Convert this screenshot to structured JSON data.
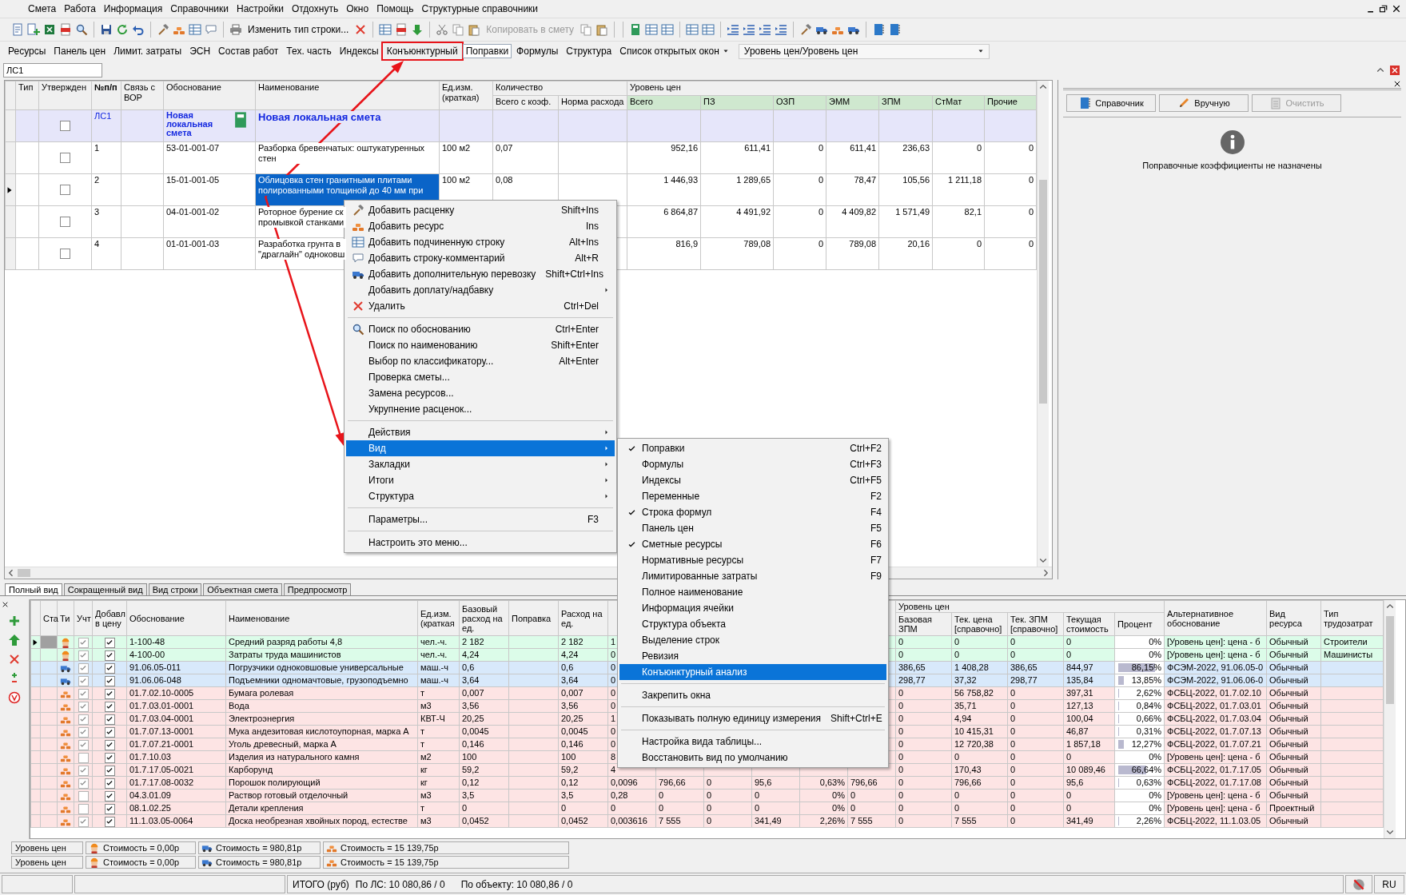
{
  "menu_bar": [
    "Смета",
    "Работа",
    "Информация",
    "Справочники",
    "Настройки",
    "Отдохнуть",
    "Окно",
    "Помощь",
    "Структурные справочники"
  ],
  "toolbar": {
    "buttons": [
      {
        "label": "Изменить тип строки...",
        "disabled": false
      },
      {
        "label": "Копировать в смету",
        "disabled": true
      }
    ]
  },
  "panel_bar": {
    "items": [
      {
        "label": "Ресурсы",
        "kind": "toggle",
        "selected": false,
        "annotated": false
      },
      {
        "label": "Панель цен",
        "kind": "toggle",
        "selected": false,
        "annotated": false
      },
      {
        "label": "Лимит. затраты",
        "kind": "toggle",
        "selected": false,
        "annotated": false
      },
      {
        "label": "ЭСН",
        "kind": "toggle",
        "selected": false,
        "annotated": false
      },
      {
        "label": "Состав работ",
        "kind": "toggle",
        "selected": false,
        "annotated": false
      },
      {
        "label": "Тех. часть",
        "kind": "toggle",
        "selected": false,
        "annotated": false
      },
      {
        "label": "Индексы",
        "kind": "toggle",
        "selected": false,
        "annotated": false
      },
      {
        "label": "Конъюнктурный",
        "kind": "toggle",
        "selected": false,
        "annotated": true
      },
      {
        "label": "Поправки",
        "kind": "toggle",
        "selected": true,
        "annotated": false
      },
      {
        "label": "Формулы",
        "kind": "toggle",
        "selected": false,
        "annotated": false
      },
      {
        "label": "Структура",
        "kind": "toggle",
        "selected": false,
        "annotated": false
      },
      {
        "label": "Список открытых окон",
        "kind": "dropdown",
        "selected": false,
        "annotated": false
      }
    ],
    "price_level": "Уровень цен/Уровень цен"
  },
  "formula_bar": {
    "value": "ЛС1"
  },
  "estimate_table": {
    "columns": [
      "Тип",
      "Утвержден",
      "№п/п",
      "Связь с ВОР",
      "Обоснование",
      "Наименование",
      "Ед.изм. (краткая)"
    ],
    "groups": [
      {
        "label": "Количество",
        "columns": [
          "Всего с коэф.",
          "Норма расхода"
        ]
      },
      {
        "label": "Уровень цен",
        "columns": [
          "Всего",
          "ПЗ",
          "ОЗП",
          "ЭММ",
          "ЗПМ",
          "СтМат",
          "Прочие"
        ]
      }
    ],
    "rows": [
      {
        "kind": "section",
        "selected": false,
        "approved": false,
        "number": "ЛС1",
        "code": "Новая локальная смета",
        "name": "Новая локальная смета"
      },
      {
        "kind": "item",
        "selected": false,
        "approved": false,
        "number": "1",
        "code": "53-01-001-07",
        "name": "Разборка бревенчатых: оштукатуренных стен",
        "unit": "100 м2",
        "qty_total": "0,07",
        "prices": [
          "952,16",
          "611,41",
          "0",
          "611,41",
          "236,63",
          "0",
          "0"
        ]
      },
      {
        "kind": "item",
        "selected": true,
        "approved": false,
        "number": "2",
        "code": "15-01-001-05",
        "name": "Облицовка стен гранитными плитами полированными толщиной до 40 мм при",
        "unit": "100 м2",
        "qty_total": "0,08",
        "prices": [
          "1 446,93",
          "1 289,65",
          "0",
          "78,47",
          "105,56",
          "1 211,18",
          "0"
        ]
      },
      {
        "kind": "item",
        "selected": false,
        "approved": false,
        "number": "3",
        "code": "04-01-001-02",
        "name": "Роторное бурение ск промывкой станками",
        "prices": [
          "6 864,87",
          "4 491,92",
          "0",
          "4 409,82",
          "1 571,49",
          "82,1",
          "0"
        ]
      },
      {
        "kind": "item",
        "selected": false,
        "approved": false,
        "number": "4",
        "code": "01-01-001-03",
        "name": "Разработка грунта в \"драглайн\" одноковш",
        "prices": [
          "816,9",
          "789,08",
          "0",
          "789,08",
          "20,16",
          "0",
          "0"
        ]
      }
    ]
  },
  "right_panel": {
    "buttons": [
      {
        "label": "Справочник",
        "disabled": false
      },
      {
        "label": "Вручную",
        "disabled": false
      },
      {
        "label": "Очистить",
        "disabled": true
      }
    ],
    "message": "Поправочные коэффициенты не назначены"
  },
  "view_tabs": [
    {
      "label": "Полный вид",
      "selected": true
    },
    {
      "label": "Сокращенный вид",
      "selected": false
    },
    {
      "label": "Вид строки",
      "selected": false
    },
    {
      "label": "Объектная смета",
      "selected": false
    },
    {
      "label": "Предпросмотр",
      "selected": false
    }
  ],
  "resource_table": {
    "columns": [
      "Ста",
      "Ти",
      "Учт",
      "Добавл в цену",
      "Обоснование",
      "Наименование",
      "Ед.изм. (краткая",
      "Базовый расход на ед.",
      "Поправка",
      "Расход на ед."
    ],
    "price_group": {
      "label": "Уровень цен",
      "columns": [
        "Базовая ЗПМ",
        "Тек. цена [справочно]",
        "Тек. ЗПМ [справочно]",
        "Текущая стоимость",
        "Процент"
      ]
    },
    "trailing": [
      "Альтернативное обоснование",
      "Вид ресурса",
      "Тип трудозатрат"
    ],
    "rows": [
      {
        "kind": "worker",
        "selected": true,
        "counted": true,
        "added": true,
        "code": "1-100-48",
        "name": "Средний разряд работы 4,8",
        "unit": "чел.-ч.",
        "base": "2 182",
        "rate": "2 182",
        "column_11": "1",
        "base_zpm": "0",
        "price": "0",
        "cur_zpm": "0",
        "cost": "0",
        "percent": "0%",
        "level": 0,
        "alt": "[Уровень цен]: цена - б",
        "resource_kind": "Обычный",
        "labor": "Строители"
      },
      {
        "kind": "worker",
        "selected": false,
        "counted": true,
        "added": true,
        "code": "4-100-00",
        "name": "Затраты труда машинистов",
        "unit": "чел.-ч.",
        "base": "4,24",
        "rate": "4,24",
        "column_11": "0",
        "base_zpm": "0",
        "price": "0",
        "cur_zpm": "0",
        "cost": "0",
        "percent": "0%",
        "level": 0,
        "alt": "[Уровень цен]: цена - б",
        "resource_kind": "Обычный",
        "labor": "Машинисты"
      },
      {
        "kind": "machine",
        "selected": false,
        "counted": true,
        "added": true,
        "code": "91.06.05-011",
        "name": "Погрузчики одноковшовые универсальные",
        "unit": "маш.-ч",
        "base": "0,6",
        "rate": "0,6",
        "column_11": "0",
        "base_zpm": "386,65",
        "price": "1 408,28",
        "cur_zpm": "386,65",
        "cost": "844,97",
        "percent": "86,15%",
        "level": 0.8615,
        "alt": "ФСЭМ-2022, 91.06.05-0",
        "resource_kind": "Обычный"
      },
      {
        "kind": "machine",
        "selected": false,
        "counted": true,
        "added": true,
        "code": "91.06.06-048",
        "name": "Подъемники одномачтовые, грузоподъемно",
        "unit": "маш.-ч",
        "base": "3,64",
        "rate": "3,64",
        "column_11": "0",
        "base_zpm": "298,77",
        "price": "37,32",
        "cur_zpm": "298,77",
        "cost": "135,84",
        "percent": "13,85%",
        "level": 0.1385,
        "alt": "ФСЭМ-2022, 91.06.06-0",
        "resource_kind": "Обычный"
      },
      {
        "kind": "material",
        "selected": false,
        "counted": true,
        "added": true,
        "code": "01.7.02.10-0005",
        "name": "Бумага ролевая",
        "unit": "т",
        "base": "0,007",
        "rate": "0,007",
        "column_11": "0",
        "base_zpm": "0",
        "price": "56 758,82",
        "cur_zpm": "0",
        "cost": "397,31",
        "percent": "2,62%",
        "level": 0.0262,
        "alt": "ФСБЦ-2022, 01.7.02.10",
        "resource_kind": "Обычный"
      },
      {
        "kind": "material",
        "selected": false,
        "counted": true,
        "added": true,
        "code": "01.7.03.01-0001",
        "name": "Вода",
        "unit": "м3",
        "base": "3,56",
        "rate": "3,56",
        "column_11": "0",
        "base_zpm": "0",
        "price": "35,71",
        "cur_zpm": "0",
        "cost": "127,13",
        "percent": "0,84%",
        "level": 0.0084,
        "alt": "ФСБЦ-2022, 01.7.03.01",
        "resource_kind": "Обычный"
      },
      {
        "kind": "material",
        "selected": false,
        "counted": true,
        "added": true,
        "code": "01.7.03.04-0001",
        "name": "Электроэнергия",
        "unit": "КВТ-Ч",
        "base": "20,25",
        "rate": "20,25",
        "column_11": "1",
        "base_zpm": "0",
        "price": "4,94",
        "cur_zpm": "0",
        "cost": "100,04",
        "percent": "0,66%",
        "level": 0.0066,
        "alt": "ФСБЦ-2022, 01.7.03.04",
        "resource_kind": "Обычный"
      },
      {
        "kind": "material",
        "selected": false,
        "counted": true,
        "added": true,
        "code": "01.7.07.13-0001",
        "name": "Мука андезитовая кислотоупорная, марка А",
        "unit": "т",
        "base": "0,0045",
        "rate": "0,0045",
        "column_11": "0",
        "base_zpm": "0",
        "price": "10 415,31",
        "cur_zpm": "0",
        "cost": "46,87",
        "percent": "0,31%",
        "level": 0.0031,
        "alt": "ФСБЦ-2022, 01.7.07.13",
        "resource_kind": "Обычный"
      },
      {
        "kind": "material",
        "selected": false,
        "counted": true,
        "added": true,
        "code": "01.7.07.21-0001",
        "name": "Уголь древесный, марка А",
        "unit": "т",
        "base": "0,146",
        "rate": "0,146",
        "column_11": "0",
        "base_zpm": "0",
        "price": "12 720,38",
        "cur_zpm": "0",
        "cost": "1 857,18",
        "percent": "12,27%",
        "level": 0.1227,
        "alt": "ФСБЦ-2022, 01.7.07.21",
        "resource_kind": "Обычный"
      },
      {
        "kind": "material",
        "selected": false,
        "counted": false,
        "added": true,
        "code": "01.7.10.03",
        "name": "Изделия из натурального камня",
        "unit": "м2",
        "base": "100",
        "rate": "100",
        "column_11": "8",
        "base_zpm": "0",
        "price": "0",
        "cur_zpm": "0",
        "cost": "0",
        "percent": "0%",
        "level": 0,
        "alt": "[Уровень цен]: цена - б",
        "resource_kind": "Обычный"
      },
      {
        "kind": "material",
        "selected": false,
        "counted": true,
        "added": true,
        "code": "01.7.17.05-0021",
        "name": "Карборунд",
        "unit": "кг",
        "base": "59,2",
        "rate": "59,2",
        "column_11": "4",
        "base_zpm": "0",
        "price": "170,43",
        "cur_zpm": "0",
        "cost": "10 089,46",
        "percent": "66,64%",
        "level": 0.6664,
        "alt": "ФСБЦ-2022, 01.7.17.05",
        "resource_kind": "Обычный"
      },
      {
        "kind": "material",
        "selected": false,
        "counted": true,
        "added": true,
        "code": "01.7.17.08-0032",
        "name": "Порошок полирующий",
        "unit": "кг",
        "base": "0,12",
        "rate": "0,12",
        "column_11": "0,0096",
        "column_12_to_16": [
          "796,66",
          "0",
          "95,6",
          "0,63%",
          "796,66"
        ],
        "base_zpm": "0",
        "price": "796,66",
        "cur_zpm": "0",
        "cost": "95,6",
        "percent": "0,63%",
        "level": 0.0063,
        "alt": "ФСБЦ-2022, 01.7.17.08",
        "resource_kind": "Обычный"
      },
      {
        "kind": "material",
        "selected": false,
        "counted": false,
        "added": true,
        "code": "04.3.01.09",
        "name": "Раствор готовый отделочный",
        "unit": "м3",
        "base": "3,5",
        "rate": "3,5",
        "column_11": "0,28",
        "column_12_to_16": [
          "0",
          "0",
          "0",
          "0%",
          "0"
        ],
        "base_zpm": "0",
        "price": "0",
        "cur_zpm": "0",
        "cost": "0",
        "percent": "0%",
        "level": 0,
        "alt": "[Уровень цен]: цена - б",
        "resource_kind": "Обычный"
      },
      {
        "kind": "material",
        "selected": false,
        "counted": false,
        "added": true,
        "code": "08.1.02.25",
        "name": "Детали крепления",
        "unit": "т",
        "base": "0",
        "rate": "0",
        "column_11": "0",
        "column_12_to_16": [
          "0",
          "0",
          "0",
          "0%",
          "0"
        ],
        "base_zpm": "0",
        "price": "0",
        "cur_zpm": "0",
        "cost": "0",
        "percent": "0%",
        "level": 0,
        "alt": "[Уровень цен]: цена - б",
        "resource_kind": "Проектный"
      },
      {
        "kind": "material",
        "selected": false,
        "counted": true,
        "added": true,
        "code": "11.1.03.05-0064",
        "name": "Доска необрезная хвойных пород, естестве",
        "unit": "м3",
        "base": "0,0452",
        "rate": "0,0452",
        "column_11": "0,003616",
        "column_12_to_16": [
          "7 555",
          "0",
          "341,49",
          "2,26%",
          "7 555"
        ],
        "base_zpm": "0",
        "price": "7 555",
        "cur_zpm": "0",
        "cost": "341,49",
        "percent": "2,26%",
        "level": 0.0226,
        "alt": "ФСБЦ-2022, 11.1.03.05",
        "resource_kind": "Обычный"
      }
    ]
  },
  "summaries": [
    {
      "label": "Уровень цен",
      "costs": [
        "Стоимость = 0,00р",
        "Стоимость = 980,81р",
        "Стоимость = 15 139,75р"
      ]
    },
    {
      "label": "Уровень цен",
      "costs": [
        "Стоимость = 0,00р",
        "Стоимость = 980,81р",
        "Стоимость = 15 139,75р"
      ]
    }
  ],
  "status_bar": {
    "total": "ИТОГО (руб)",
    "by_estimate": "По ЛС: 10 080,86 / 0",
    "by_object": "По объекту: 10 080,86 / 0",
    "language": "RU"
  },
  "context_menu": {
    "groups": [
      [
        {
          "label": "Добавить расценку",
          "shortcut": "Shift+Ins",
          "submenu": false,
          "selected": false
        },
        {
          "label": "Добавить ресурс",
          "shortcut": "Ins",
          "submenu": false,
          "selected": false
        },
        {
          "label": "Добавить подчиненную строку",
          "shortcut": "Alt+Ins",
          "submenu": false,
          "selected": false
        },
        {
          "label": "Добавить строку-комментарий",
          "shortcut": "Alt+R",
          "submenu": false,
          "selected": false
        },
        {
          "label": "Добавить дополнительную перевозку",
          "shortcut": "Shift+Ctrl+Ins",
          "submenu": false,
          "selected": false
        },
        {
          "label": "Добавить доплату/надбавку",
          "submenu": true,
          "selected": false
        },
        {
          "label": "Удалить",
          "shortcut": "Ctrl+Del",
          "submenu": false,
          "selected": false
        }
      ],
      [
        {
          "label": "Поиск по обоснованию",
          "shortcut": "Ctrl+Enter",
          "submenu": false,
          "selected": false
        },
        {
          "label": "Поиск по наименованию",
          "shortcut": "Shift+Enter",
          "submenu": false,
          "selected": false
        },
        {
          "label": "Выбор по классификатору...",
          "shortcut": "Alt+Enter",
          "submenu": false,
          "selected": false
        },
        {
          "label": "Проверка сметы...",
          "submenu": false,
          "selected": false
        },
        {
          "label": "Замена ресурсов...",
          "submenu": false,
          "selected": false
        },
        {
          "label": "Укрупнение расценок...",
          "submenu": false,
          "selected": false
        }
      ],
      [
        {
          "label": "Действия",
          "submenu": true,
          "selected": false
        },
        {
          "label": "Вид",
          "submenu": true,
          "selected": true
        },
        {
          "label": "Закладки",
          "submenu": true,
          "selected": false
        },
        {
          "label": "Итоги",
          "submenu": true,
          "selected": false
        },
        {
          "label": "Структура",
          "submenu": true,
          "selected": false
        }
      ],
      [
        {
          "label": "Параметры...",
          "shortcut": "F3",
          "submenu": false,
          "selected": false
        }
      ],
      [
        {
          "label": "Настроить это меню...",
          "submenu": false,
          "selected": false
        }
      ]
    ]
  },
  "view_submenu": {
    "groups": [
      [
        {
          "label": "Поправки",
          "shortcut": "Ctrl+F2",
          "checked": true,
          "selected": false
        },
        {
          "label": "Формулы",
          "shortcut": "Ctrl+F3",
          "checked": false,
          "selected": false
        },
        {
          "label": "Индексы",
          "shortcut": "Ctrl+F5",
          "checked": false,
          "selected": false
        },
        {
          "label": "Переменные",
          "shortcut": "F2",
          "checked": false,
          "selected": false
        },
        {
          "label": "Строка формул",
          "shortcut": "F4",
          "checked": true,
          "selected": false
        },
        {
          "label": "Панель цен",
          "shortcut": "F5",
          "checked": false,
          "selected": false
        },
        {
          "label": "Сметные ресурсы",
          "shortcut": "F6",
          "checked": true,
          "selected": false
        },
        {
          "label": "Нормативные ресурсы",
          "shortcut": "F7",
          "checked": false,
          "selected": false
        },
        {
          "label": "Лимитированные затраты",
          "shortcut": "F9",
          "checked": false,
          "selected": false
        },
        {
          "label": "Полное наименование",
          "checked": false,
          "selected": false
        },
        {
          "label": "Информация ячейки",
          "checked": false,
          "selected": false
        },
        {
          "label": "Структура объекта",
          "checked": false,
          "selected": false
        },
        {
          "label": "Выделение строк",
          "checked": false,
          "selected": false
        },
        {
          "label": "Ревизия",
          "checked": false,
          "selected": false
        },
        {
          "label": "Конъюнктурный анализ",
          "checked": false,
          "selected": true
        }
      ],
      [
        {
          "label": "Закрепить окна",
          "checked": false,
          "selected": false
        }
      ],
      [
        {
          "label": "Показывать полную единицу измерения",
          "shortcut": "Shift+Ctrl+E",
          "checked": false,
          "selected": false
        }
      ],
      [
        {
          "label": "Настройка вида таблицы...",
          "checked": false,
          "selected": false
        },
        {
          "label": "Восстановить вид по умолчанию",
          "checked": false,
          "selected": false
        }
      ]
    ]
  }
}
